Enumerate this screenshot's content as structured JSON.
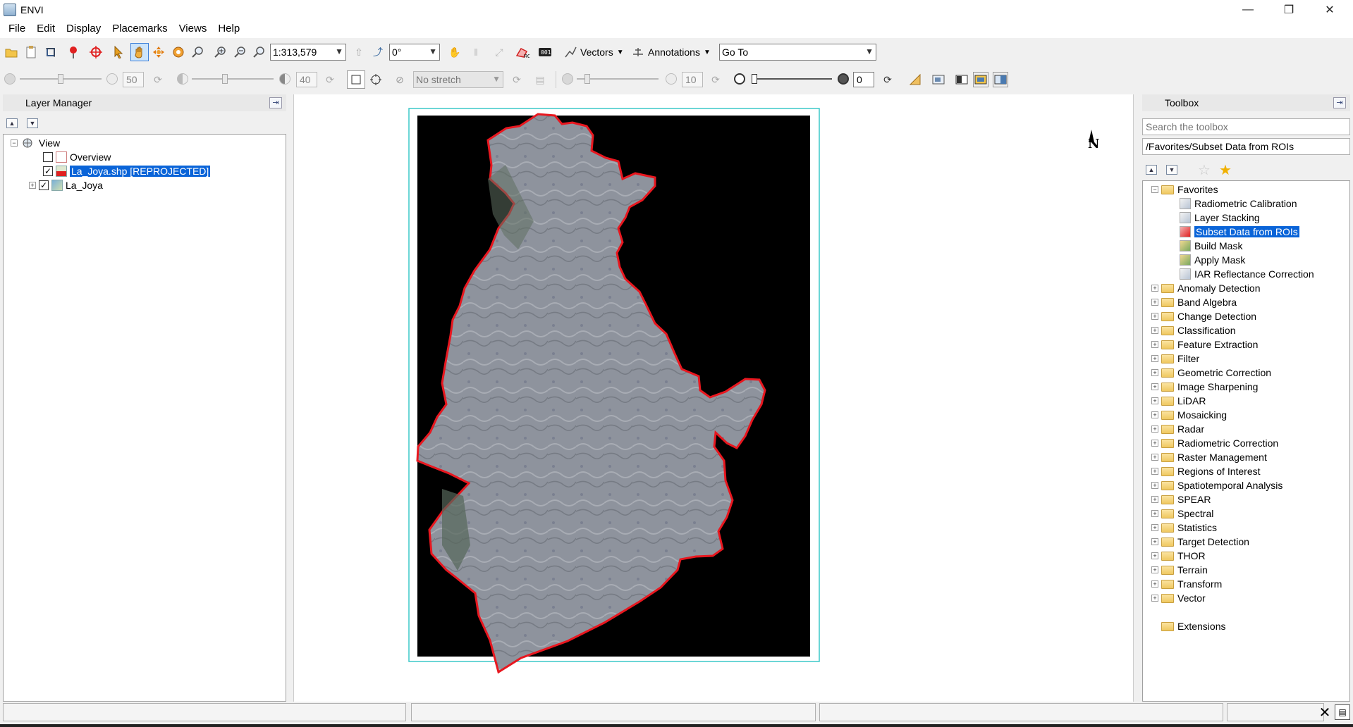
{
  "window": {
    "title": "ENVI",
    "minimize": "—",
    "maximize": "❐",
    "close": "✕"
  },
  "menu": [
    "File",
    "Edit",
    "Display",
    "Placemarks",
    "Views",
    "Help"
  ],
  "toolbar1": {
    "scale": "1:313,579",
    "rotation": "0°",
    "vectors_label": "Vectors",
    "annotations_label": "Annotations",
    "goto": "Go To"
  },
  "toolbar2": {
    "brightness": "50",
    "contrast": "40",
    "stretch": "No stretch",
    "sharpen": "10",
    "transparency": "0"
  },
  "layer_manager": {
    "title": "Layer Manager",
    "tree": [
      {
        "label": "View",
        "level": 0,
        "expanded": true
      },
      {
        "label": "Overview",
        "level": 1,
        "checked": false
      },
      {
        "label": "La_Joya.shp [REPROJECTED]",
        "level": 1,
        "checked": true,
        "selected": true
      },
      {
        "label": "La_Joya",
        "level": 1,
        "checked": true
      }
    ]
  },
  "view": {
    "north_label": "N"
  },
  "toolbox": {
    "title": "Toolbox",
    "search_placeholder": "Search the toolbox",
    "path": "/Favorites/Subset Data from ROIs",
    "favorites_label": "Favorites",
    "favorites": [
      {
        "label": "Radiometric Calibration",
        "icon": "calibration-icon"
      },
      {
        "label": "Layer Stacking",
        "icon": "layer-stacking-icon"
      },
      {
        "label": "Subset Data from ROIs",
        "icon": "roi-subset-icon",
        "selected": true
      },
      {
        "label": "Build Mask",
        "icon": "mask-icon"
      },
      {
        "label": "Apply Mask",
        "icon": "mask-icon"
      },
      {
        "label": "IAR Reflectance Correction",
        "icon": "calibration-icon"
      }
    ],
    "folders": [
      "Anomaly Detection",
      "Band Algebra",
      "Change Detection",
      "Classification",
      "Feature Extraction",
      "Filter",
      "Geometric Correction",
      "Image Sharpening",
      "LiDAR",
      "Mosaicking",
      "Radar",
      "Radiometric Correction",
      "Raster Management",
      "Regions of Interest",
      "Spatiotemporal Analysis",
      "SPEAR",
      "Spectral",
      "Statistics",
      "Target Detection",
      "THOR",
      "Terrain",
      "Transform",
      "Vector"
    ],
    "extensions_label": "Extensions"
  },
  "colors": {
    "roi_outline": "#e8171f",
    "selection": "#0a64d8",
    "view_border": "#3cc8c8"
  }
}
